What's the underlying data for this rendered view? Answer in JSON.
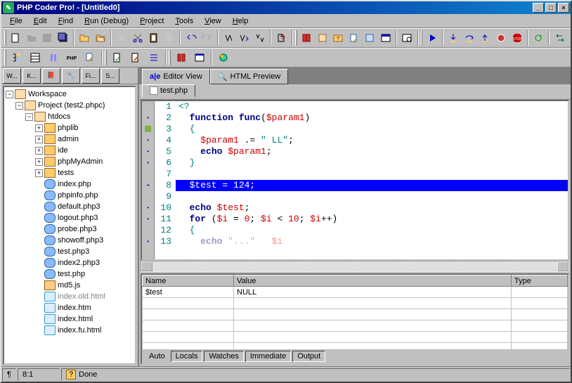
{
  "title": "PHP Coder Pro! - [Untitled0]",
  "menu": [
    "File",
    "Edit",
    "Find",
    "Run (Debug)",
    "Project",
    "Tools",
    "View",
    "Help"
  ],
  "leftTabs": [
    "W...",
    "K...",
    "📕",
    "🔧",
    "Fi...",
    "S..."
  ],
  "tree": {
    "root": "Workspace",
    "project": "Project (test2.phpc)",
    "htdocs": "htdocs",
    "dirs": [
      "phplib",
      "admin",
      "ide",
      "phpMyAdmin",
      "tests"
    ],
    "files": [
      {
        "n": "index.php",
        "t": "php"
      },
      {
        "n": "phpinfo.php",
        "t": "php"
      },
      {
        "n": "default.php3",
        "t": "php"
      },
      {
        "n": "logout.php3",
        "t": "php"
      },
      {
        "n": "probe.php3",
        "t": "php"
      },
      {
        "n": "showoff.php3",
        "t": "php"
      },
      {
        "n": "test.php3",
        "t": "php"
      },
      {
        "n": "index2.php3",
        "t": "php"
      },
      {
        "n": "test.php",
        "t": "php"
      },
      {
        "n": "md5.js",
        "t": "js"
      },
      {
        "n": "index.old.html",
        "t": "ie",
        "cut": true
      },
      {
        "n": "index.htm",
        "t": "ie"
      },
      {
        "n": "index.html",
        "t": "ie"
      },
      {
        "n": "index.fu.html",
        "t": "ie"
      }
    ]
  },
  "editorTabs": {
    "editorView": "Editor View",
    "htmlPreview": "HTML Preview"
  },
  "fileTab": "test.php",
  "code": [
    {
      "n": 1,
      "m": "",
      "html": "<span class='brace'>&lt;?</span>"
    },
    {
      "n": 2,
      "m": "•",
      "html": "  <span class='kw'>function</span> <span class='kw'>func</span>(<span class='var'>$param1</span>)"
    },
    {
      "n": 3,
      "m": "🟩",
      "html": "  <span class='brace'>{</span>"
    },
    {
      "n": 4,
      "m": "•",
      "html": "    <span class='var'>$param1</span> .= <span class='str'>\" LL\"</span>;"
    },
    {
      "n": 5,
      "m": "•",
      "html": "    <span class='kw'>echo</span> <span class='var'>$param1</span>;"
    },
    {
      "n": 6,
      "m": "•",
      "html": "  <span class='brace'>}</span>"
    },
    {
      "n": 7,
      "m": "",
      "html": ""
    },
    {
      "n": 8,
      "m": "➔",
      "hl": true,
      "html": "  $test = 124;"
    },
    {
      "n": 9,
      "m": "",
      "html": ""
    },
    {
      "n": 10,
      "m": "•",
      "html": "  <span class='kw'>echo</span> <span class='var'>$test</span>;"
    },
    {
      "n": 11,
      "m": "•",
      "html": "  <span class='kw'>for</span> (<span class='var'>$i</span> = <span class='num'>0</span>; <span class='var'>$i</span> &lt; <span class='num'>10</span>; <span class='var'>$i</span>++)"
    },
    {
      "n": 12,
      "m": "",
      "html": "  <span class='brace'>{</span>"
    },
    {
      "n": 13,
      "m": "•",
      "html": "    <span class='kw' style='opacity:.4'>echo</span> <span class='str' style='opacity:.4'>\"...\"</span>   <span class='var' style='opacity:.4'>$i</span>"
    }
  ],
  "debug": {
    "headers": [
      "Name",
      "Value",
      "Type"
    ],
    "rows": [
      {
        "name": "$test",
        "value": "NULL",
        "type": ""
      }
    ],
    "tabs": [
      "Auto",
      "Locals",
      "Watches",
      "Immediate",
      "Output"
    ]
  },
  "status": {
    "pos": "8:1",
    "msg": "Done"
  }
}
